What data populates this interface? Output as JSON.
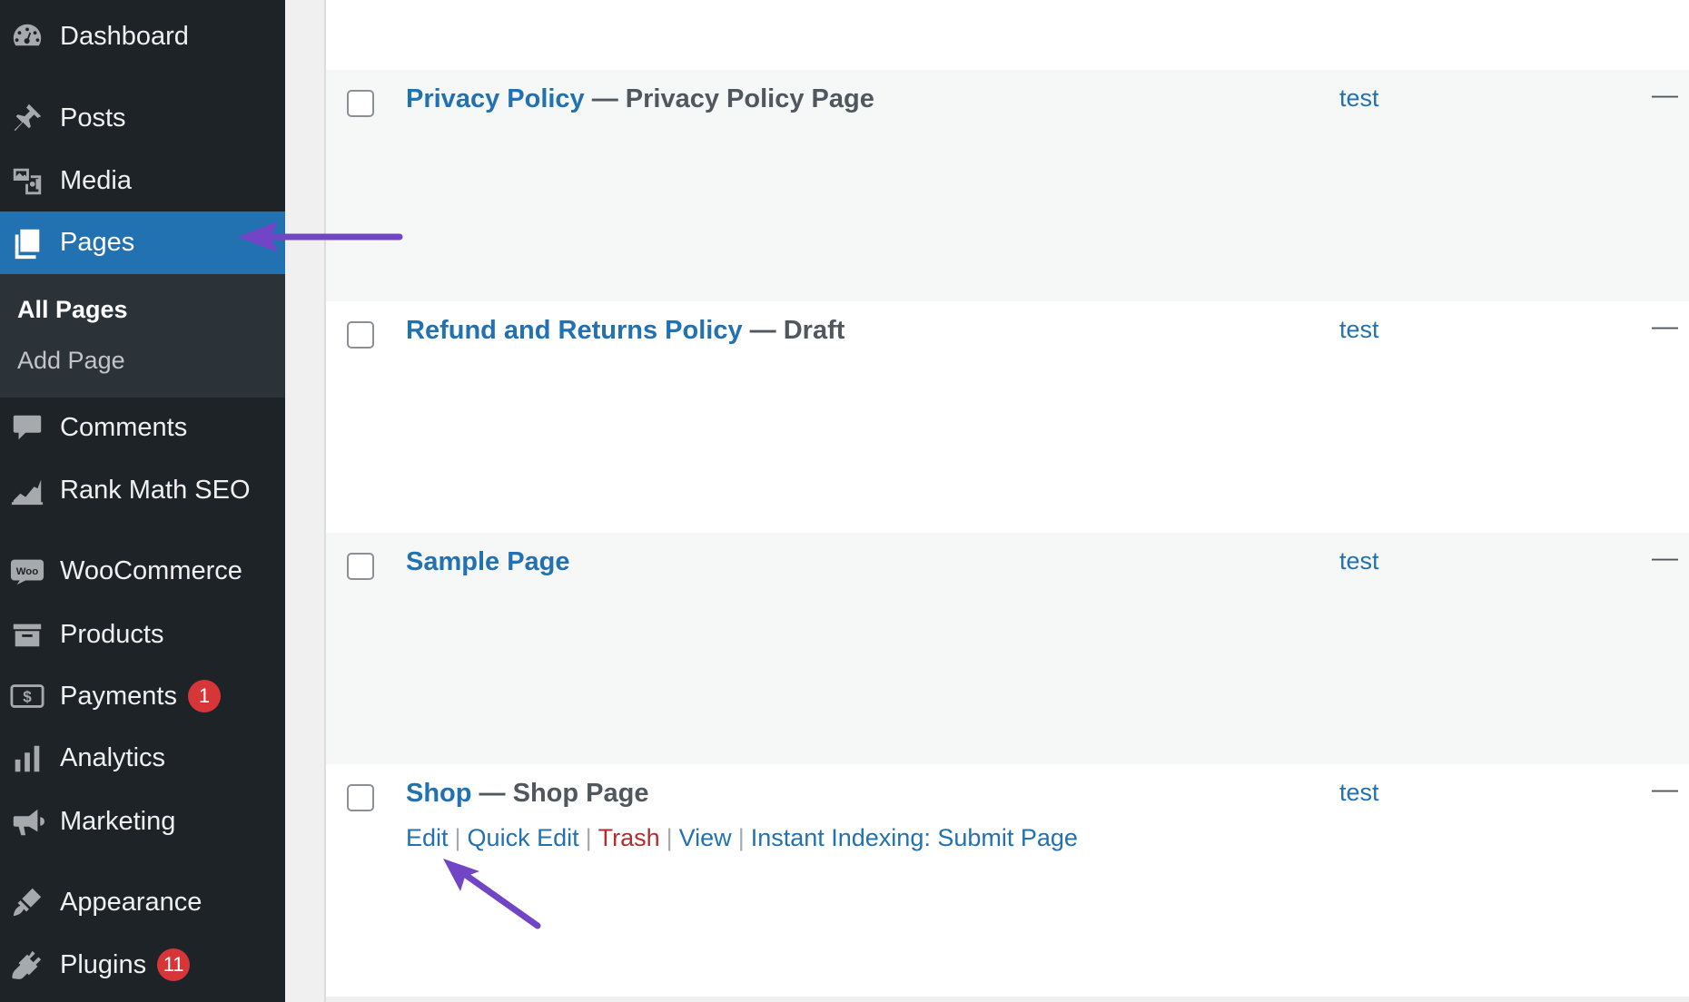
{
  "sidebar": {
    "items": [
      {
        "label": "Dashboard",
        "icon": "dashboard-icon"
      },
      {
        "label": "Posts",
        "icon": "pin-icon"
      },
      {
        "label": "Media",
        "icon": "media-icon"
      },
      {
        "label": "Pages",
        "icon": "pages-icon",
        "active": true
      },
      {
        "label": "Comments",
        "icon": "comment-bubble-icon"
      },
      {
        "label": "Rank Math SEO",
        "icon": "rank-math-icon"
      },
      {
        "label": "WooCommerce",
        "icon": "woo-icon"
      },
      {
        "label": "Products",
        "icon": "archive-box-icon"
      },
      {
        "label": "Payments",
        "icon": "dollar-icon",
        "badge": "1"
      },
      {
        "label": "Analytics",
        "icon": "bar-chart-icon"
      },
      {
        "label": "Marketing",
        "icon": "megaphone-icon"
      },
      {
        "label": "Appearance",
        "icon": "paintbrush-icon"
      },
      {
        "label": "Plugins",
        "icon": "plug-icon",
        "badge": "11"
      }
    ],
    "submenu": [
      "All Pages",
      "Add Page"
    ]
  },
  "pages_table": {
    "rows": [
      {
        "title": "Privacy Policy",
        "state": " — Privacy Policy Page",
        "author": "test",
        "date": "—"
      },
      {
        "title": "Refund and Returns Policy",
        "state": " — Draft",
        "author": "test",
        "date": "—"
      },
      {
        "title": "Sample Page",
        "state": "",
        "author": "test",
        "date": "—"
      },
      {
        "title": "Shop",
        "state": " — Shop Page",
        "author": "test",
        "date": "—"
      }
    ],
    "row_actions": [
      "Edit",
      "Quick Edit",
      "Trash",
      "View",
      "Instant Indexing: Submit Page"
    ]
  },
  "colors": {
    "sidebar_bg": "#1d2327",
    "active_bg": "#2271b1",
    "link": "#2271b1",
    "trash": "#b32d2e",
    "badge": "#d63638",
    "annotation_arrow": "#7145c5"
  }
}
